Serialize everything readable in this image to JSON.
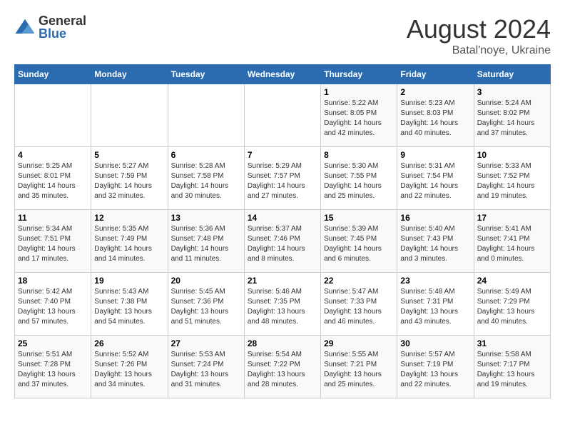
{
  "header": {
    "logo_general": "General",
    "logo_blue": "Blue",
    "month_year": "August 2024",
    "location": "Batal'noye, Ukraine"
  },
  "calendar": {
    "days_of_week": [
      "Sunday",
      "Monday",
      "Tuesday",
      "Wednesday",
      "Thursday",
      "Friday",
      "Saturday"
    ],
    "weeks": [
      [
        {
          "day": "",
          "info": ""
        },
        {
          "day": "",
          "info": ""
        },
        {
          "day": "",
          "info": ""
        },
        {
          "day": "",
          "info": ""
        },
        {
          "day": "1",
          "info": "Sunrise: 5:22 AM\nSunset: 8:05 PM\nDaylight: 14 hours\nand 42 minutes."
        },
        {
          "day": "2",
          "info": "Sunrise: 5:23 AM\nSunset: 8:03 PM\nDaylight: 14 hours\nand 40 minutes."
        },
        {
          "day": "3",
          "info": "Sunrise: 5:24 AM\nSunset: 8:02 PM\nDaylight: 14 hours\nand 37 minutes."
        }
      ],
      [
        {
          "day": "4",
          "info": "Sunrise: 5:25 AM\nSunset: 8:01 PM\nDaylight: 14 hours\nand 35 minutes."
        },
        {
          "day": "5",
          "info": "Sunrise: 5:27 AM\nSunset: 7:59 PM\nDaylight: 14 hours\nand 32 minutes."
        },
        {
          "day": "6",
          "info": "Sunrise: 5:28 AM\nSunset: 7:58 PM\nDaylight: 14 hours\nand 30 minutes."
        },
        {
          "day": "7",
          "info": "Sunrise: 5:29 AM\nSunset: 7:57 PM\nDaylight: 14 hours\nand 27 minutes."
        },
        {
          "day": "8",
          "info": "Sunrise: 5:30 AM\nSunset: 7:55 PM\nDaylight: 14 hours\nand 25 minutes."
        },
        {
          "day": "9",
          "info": "Sunrise: 5:31 AM\nSunset: 7:54 PM\nDaylight: 14 hours\nand 22 minutes."
        },
        {
          "day": "10",
          "info": "Sunrise: 5:33 AM\nSunset: 7:52 PM\nDaylight: 14 hours\nand 19 minutes."
        }
      ],
      [
        {
          "day": "11",
          "info": "Sunrise: 5:34 AM\nSunset: 7:51 PM\nDaylight: 14 hours\nand 17 minutes."
        },
        {
          "day": "12",
          "info": "Sunrise: 5:35 AM\nSunset: 7:49 PM\nDaylight: 14 hours\nand 14 minutes."
        },
        {
          "day": "13",
          "info": "Sunrise: 5:36 AM\nSunset: 7:48 PM\nDaylight: 14 hours\nand 11 minutes."
        },
        {
          "day": "14",
          "info": "Sunrise: 5:37 AM\nSunset: 7:46 PM\nDaylight: 14 hours\nand 8 minutes."
        },
        {
          "day": "15",
          "info": "Sunrise: 5:39 AM\nSunset: 7:45 PM\nDaylight: 14 hours\nand 6 minutes."
        },
        {
          "day": "16",
          "info": "Sunrise: 5:40 AM\nSunset: 7:43 PM\nDaylight: 14 hours\nand 3 minutes."
        },
        {
          "day": "17",
          "info": "Sunrise: 5:41 AM\nSunset: 7:41 PM\nDaylight: 14 hours\nand 0 minutes."
        }
      ],
      [
        {
          "day": "18",
          "info": "Sunrise: 5:42 AM\nSunset: 7:40 PM\nDaylight: 13 hours\nand 57 minutes."
        },
        {
          "day": "19",
          "info": "Sunrise: 5:43 AM\nSunset: 7:38 PM\nDaylight: 13 hours\nand 54 minutes."
        },
        {
          "day": "20",
          "info": "Sunrise: 5:45 AM\nSunset: 7:36 PM\nDaylight: 13 hours\nand 51 minutes."
        },
        {
          "day": "21",
          "info": "Sunrise: 5:46 AM\nSunset: 7:35 PM\nDaylight: 13 hours\nand 48 minutes."
        },
        {
          "day": "22",
          "info": "Sunrise: 5:47 AM\nSunset: 7:33 PM\nDaylight: 13 hours\nand 46 minutes."
        },
        {
          "day": "23",
          "info": "Sunrise: 5:48 AM\nSunset: 7:31 PM\nDaylight: 13 hours\nand 43 minutes."
        },
        {
          "day": "24",
          "info": "Sunrise: 5:49 AM\nSunset: 7:29 PM\nDaylight: 13 hours\nand 40 minutes."
        }
      ],
      [
        {
          "day": "25",
          "info": "Sunrise: 5:51 AM\nSunset: 7:28 PM\nDaylight: 13 hours\nand 37 minutes."
        },
        {
          "day": "26",
          "info": "Sunrise: 5:52 AM\nSunset: 7:26 PM\nDaylight: 13 hours\nand 34 minutes."
        },
        {
          "day": "27",
          "info": "Sunrise: 5:53 AM\nSunset: 7:24 PM\nDaylight: 13 hours\nand 31 minutes."
        },
        {
          "day": "28",
          "info": "Sunrise: 5:54 AM\nSunset: 7:22 PM\nDaylight: 13 hours\nand 28 minutes."
        },
        {
          "day": "29",
          "info": "Sunrise: 5:55 AM\nSunset: 7:21 PM\nDaylight: 13 hours\nand 25 minutes."
        },
        {
          "day": "30",
          "info": "Sunrise: 5:57 AM\nSunset: 7:19 PM\nDaylight: 13 hours\nand 22 minutes."
        },
        {
          "day": "31",
          "info": "Sunrise: 5:58 AM\nSunset: 7:17 PM\nDaylight: 13 hours\nand 19 minutes."
        }
      ]
    ]
  }
}
